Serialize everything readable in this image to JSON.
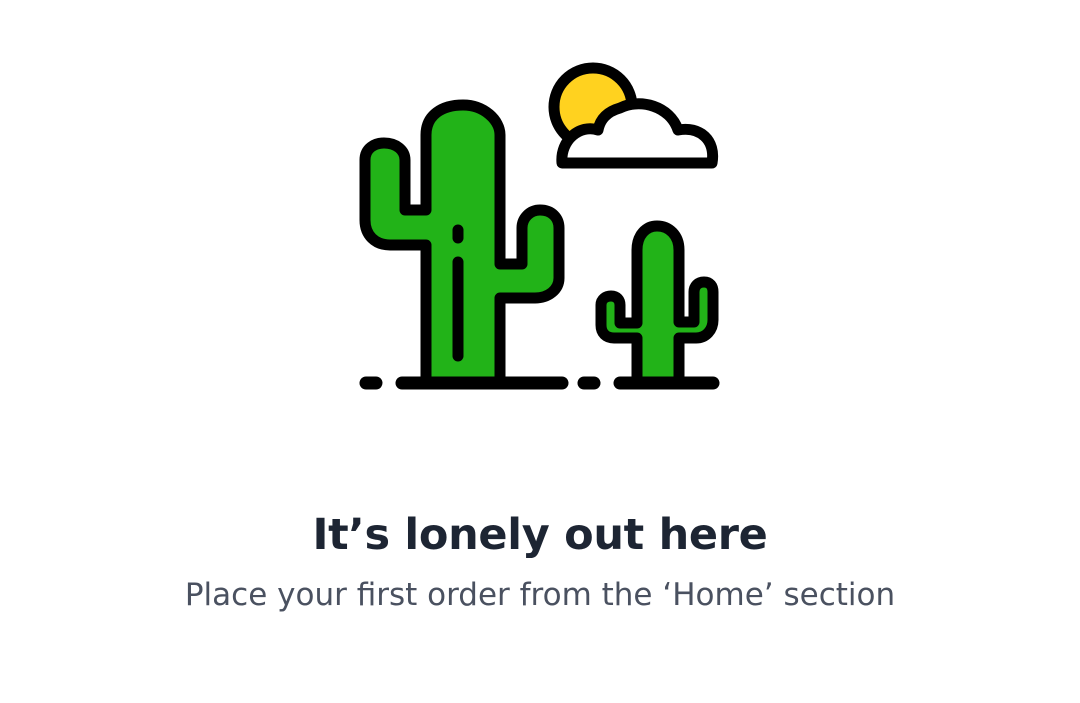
{
  "empty_state": {
    "illustration_icon": "desert-cactus-sun-cloud-icon",
    "title": "It’s lonely out here",
    "subtitle": "Place your first order from the ‘Home’ section"
  },
  "colors": {
    "background": "#ffffff",
    "cactus_green": "#22b318",
    "sun_yellow": "#ffd21f",
    "outline": "#000000",
    "title_text": "#1d2533",
    "subtitle_text": "#4a5160"
  }
}
